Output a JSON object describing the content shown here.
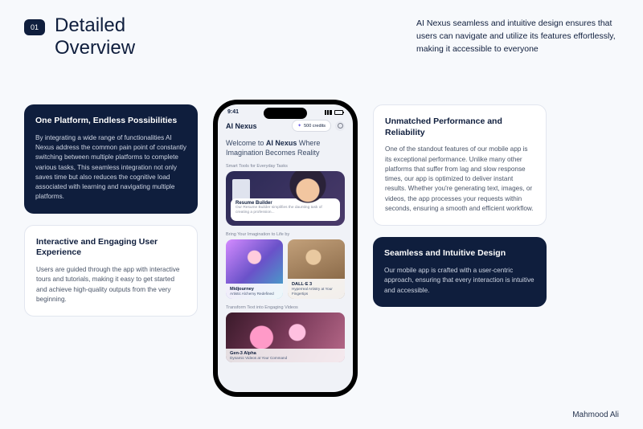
{
  "header": {
    "badge": "01",
    "title_line1": "Detailed",
    "title_line2": "Overview",
    "subtitle": "AI Nexus seamless and intuitive design ensures that users can navigate and utilize its features effortlessly, making it accessible to everyone"
  },
  "cards": {
    "tl": {
      "title": "One Platform, Endless Possibilities",
      "body": "By integrating a wide range of functionalities AI Nexus address the common pain point of constantly switching between multiple platforms to complete various tasks, This seamless integration not only saves time but also reduces the cognitive load associated with learning and navigating multiple platforms."
    },
    "bl": {
      "title": "Interactive and Engaging User Experience",
      "body": "Users are guided through the app with interactive tours and tutorials, making it easy to get started and achieve high-quality outputs from the very beginning."
    },
    "tr": {
      "title": "Unmatched Performance and Reliability",
      "body": "One of the standout features of our mobile app is its exceptional performance. Unlike many other platforms that suffer from lag and slow response times, our app is optimized to deliver instant results. Whether you're generating text, images, or videos, the app processes your requests within seconds, ensuring a smooth and efficient workflow."
    },
    "br": {
      "title": "Seamless and Intuitive Design",
      "body": "Our mobile app is crafted with a user-centric approach, ensuring that every interaction is intuitive and accessible."
    }
  },
  "phone": {
    "time": "9:41",
    "app_name": "AI Nexus",
    "credits": "500 credits",
    "welcome_pre": "Welcome to ",
    "welcome_bold": "AI Nexus",
    "welcome_post": " Where Imagination Becomes Reality",
    "sec1": "Smart Tools for Everyday Tasks",
    "resume_title": "Resume Builder",
    "resume_desc": "Our Resume Builder simplifies the daunting task of creating a profession...",
    "sec2": "Bring Your Imagination to Life by",
    "mj_title": "Midjourney",
    "mj_desc": "Artistic Alchemy Redefined",
    "de_title": "DALL·E 3",
    "de_desc": "Hyperreal Artistry at Your Fingertips",
    "sec3": "Transform Text into Engaging Videos",
    "gen_title": "Gen-3 Alpha",
    "gen_desc": "Dynamic Videos at Your Command"
  },
  "author": "Mahmood Ali"
}
